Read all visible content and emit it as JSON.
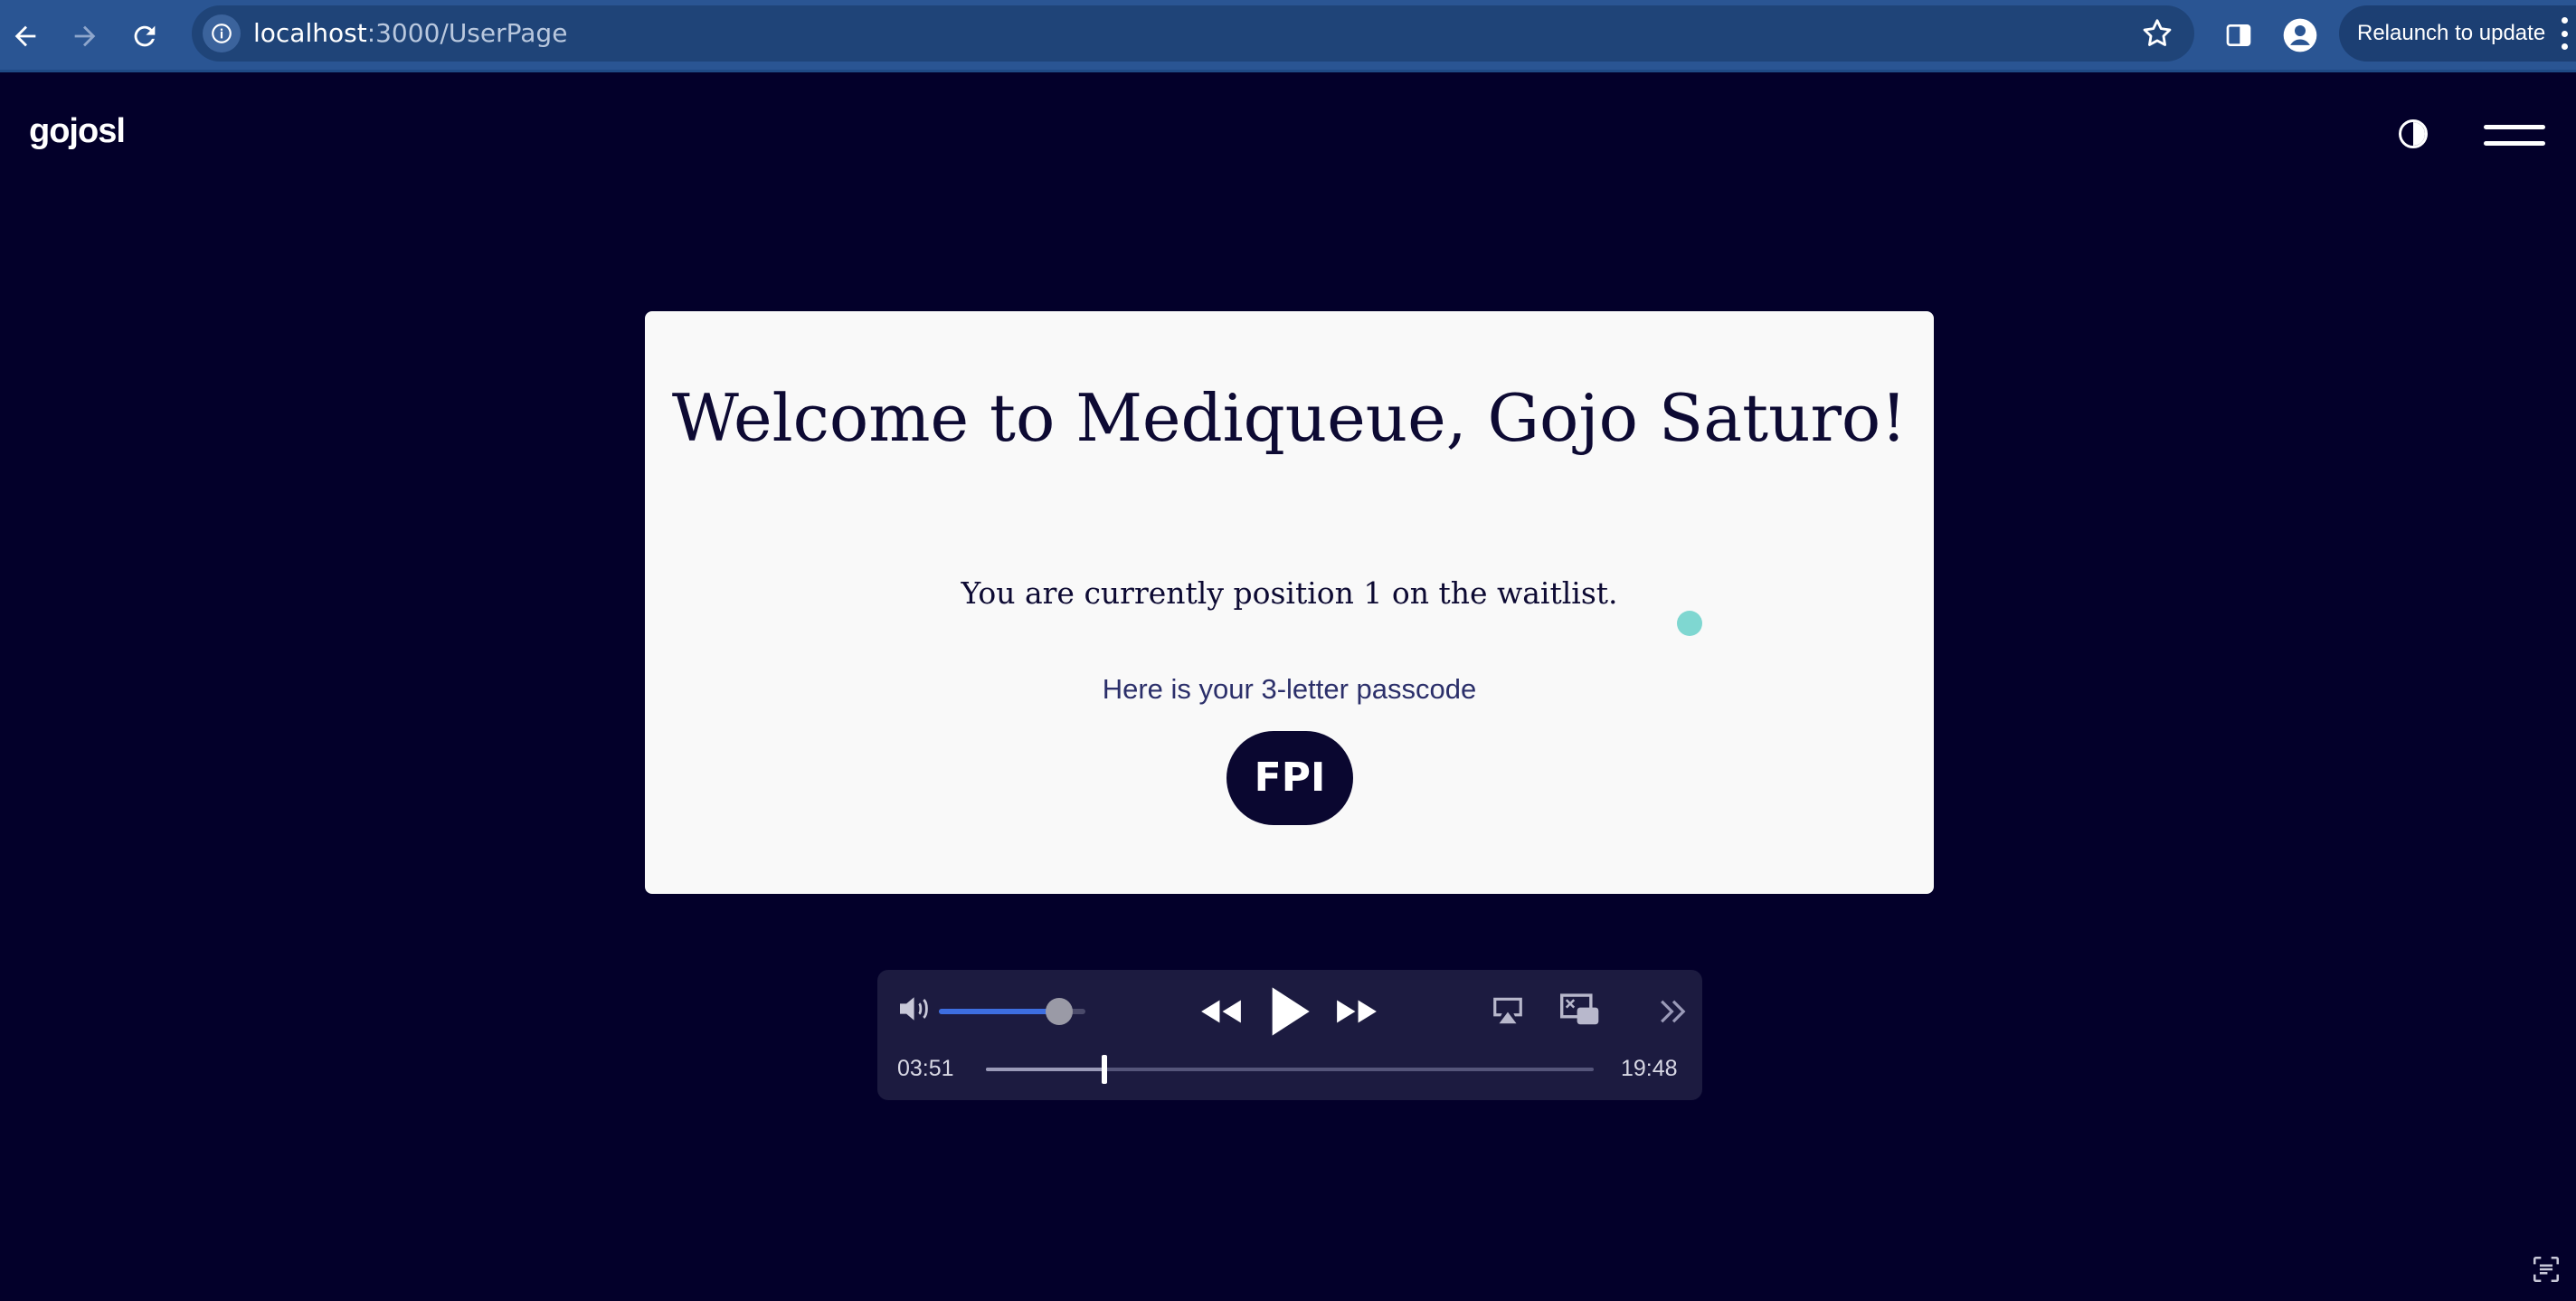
{
  "browser": {
    "url_host": "localhost",
    "url_rest": ":3000/UserPage",
    "relaunch_label": "Relaunch to update"
  },
  "app": {
    "logo": "gojosl"
  },
  "card": {
    "title": "Welcome to Mediqueue, Gojo Saturo!",
    "position_text": "You are currently position 1 on the waitlist.",
    "passcode_label": "Here is your 3-letter passcode",
    "passcode": "FPI"
  },
  "player": {
    "elapsed": "03:51",
    "duration": "19:48",
    "volume_fraction": 0.82,
    "progress_fraction": 0.195
  },
  "colors": {
    "page_bg": "#03002a",
    "chrome_bg": "#2a5593",
    "card_bg": "#f9f9f9",
    "passcode_bg": "#0a0730",
    "accent_teal": "#7fd7d1",
    "volume_accent": "#3d6ee0"
  },
  "icons": [
    "back-icon",
    "forward-icon",
    "reload-icon",
    "site-info-icon",
    "bookmark-star-icon",
    "side-panel-icon",
    "profile-icon",
    "more-vert-icon",
    "theme-toggle-icon",
    "hamburger-menu-icon",
    "volume-icon",
    "rewind-icon",
    "play-icon",
    "fast-forward-icon",
    "airplay-icon",
    "picture-in-picture-icon",
    "skip-forward-icon",
    "google-lens-icon"
  ]
}
